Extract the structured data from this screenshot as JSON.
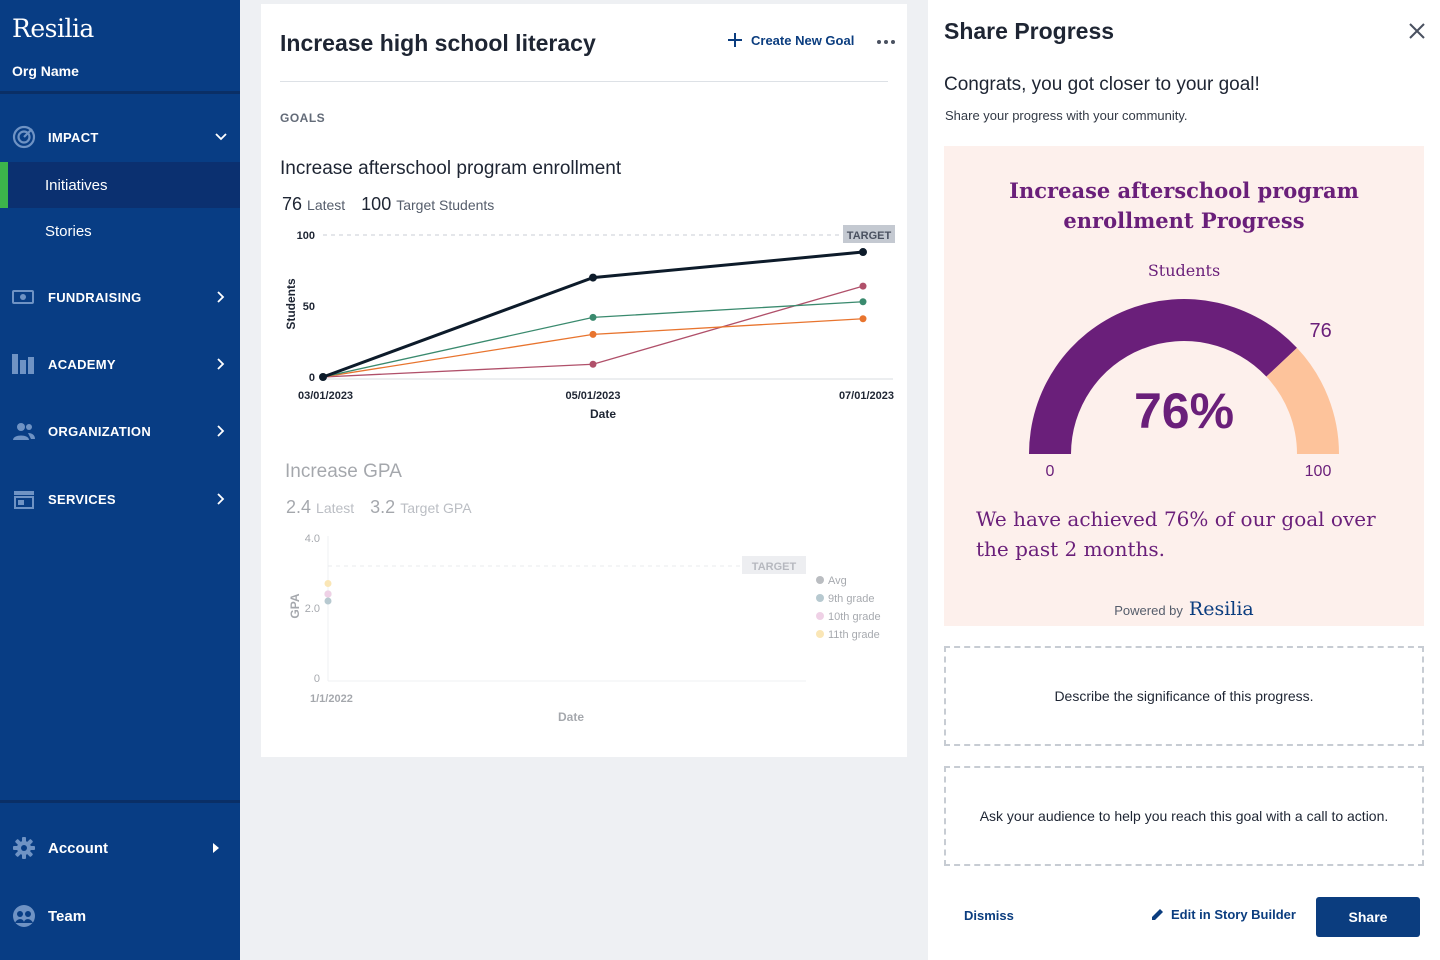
{
  "app": {
    "brand": "Resilia",
    "org_name": "Org Name"
  },
  "sidebar": {
    "sections": [
      {
        "label": "IMPACT",
        "icon": "impact-icon",
        "expanded": true
      },
      {
        "label": "FUNDRAISING",
        "icon": "fundraising-icon"
      },
      {
        "label": "ACADEMY",
        "icon": "academy-icon"
      },
      {
        "label": "ORGANIZATION",
        "icon": "organization-icon"
      },
      {
        "label": "SERVICES",
        "icon": "services-icon"
      }
    ],
    "impact_items": [
      {
        "label": "Initiatives",
        "active": true
      },
      {
        "label": "Stories"
      }
    ],
    "bottom": [
      {
        "label": "Account",
        "icon": "gear-icon"
      },
      {
        "label": "Team",
        "icon": "team-icon"
      }
    ],
    "colors": {
      "bg": "#083d84",
      "active_marker": "#3cb44b"
    }
  },
  "main": {
    "title": "Increase high school literacy",
    "create_goal_label": "Create New Goal",
    "goals_heading": "GOALS",
    "goal1": {
      "title": "Increase afterschool program enrollment",
      "latest_value": "76",
      "latest_label": "Latest",
      "target_value": "100",
      "target_label": "Target Students"
    },
    "goal2": {
      "title": "Increase GPA",
      "latest_value": "2.4",
      "latest_label": "Latest",
      "target_value": "3.2",
      "target_label": "Target GPA"
    }
  },
  "chart_data": [
    {
      "type": "line",
      "x": [
        "03/01/2023",
        "05/01/2023",
        "07/01/2023"
      ],
      "xlabel": "Date",
      "ylabel": "Students",
      "ylim": [
        0,
        100
      ],
      "yticks": [
        0,
        50,
        100
      ],
      "target": {
        "label": "TARGET",
        "value": 100
      },
      "series": [
        {
          "color": "#0d1b2a",
          "values": [
            0,
            70,
            88
          ]
        },
        {
          "color": "#3a8a6e",
          "values": [
            0,
            42,
            53
          ]
        },
        {
          "color": "#e8742e",
          "values": [
            0,
            30,
            41
          ]
        },
        {
          "color": "#b0506a",
          "values": [
            0,
            9,
            64
          ]
        }
      ]
    },
    {
      "type": "scatter",
      "x": [
        "1/1/2022"
      ],
      "xlabel": "Date",
      "ylabel": "GPA",
      "ylim": [
        0,
        4
      ],
      "yticks": [
        "0",
        "2.0",
        "4.0"
      ],
      "target": {
        "label": "TARGET",
        "value": 3.2
      },
      "legend_position": "right",
      "series": [
        {
          "name": "Avg",
          "color": "#555b66",
          "values": [
            2.4
          ]
        },
        {
          "name": "9th grade",
          "color": "#4d7a8c",
          "values": [
            2.2
          ]
        },
        {
          "name": "10th grade",
          "color": "#d98fc3",
          "values": [
            2.4
          ]
        },
        {
          "name": "11th grade",
          "color": "#f4c34a",
          "values": [
            2.7
          ]
        }
      ]
    }
  ],
  "panel": {
    "title": "Share Progress",
    "congrats": "Congrats, you got closer to your goal!",
    "subtitle": "Share your progress with your community.",
    "card": {
      "title": "Increase afterschool program enrollment Progress",
      "unit": "Students",
      "gauge": {
        "value": 76,
        "min": 0,
        "max": 100,
        "percent_label": "76%",
        "min_label": "0",
        "max_label": "100",
        "value_label": "76",
        "filled_color": "#6a1f7a",
        "remaining_color": "#fdc39b"
      },
      "description": "We have achieved 76% of our goal over the past 2 months.",
      "powered_by": "Powered by",
      "powered_brand": "Resilia",
      "bg": "#fdf0ec"
    },
    "significance_prompt": "Describe the significance of this progress.",
    "cta_prompt": "Ask your audience to help you reach this goal with a call to action.",
    "dismiss_label": "Dismiss",
    "edit_label": "Edit in Story Builder",
    "share_label": "Share"
  }
}
